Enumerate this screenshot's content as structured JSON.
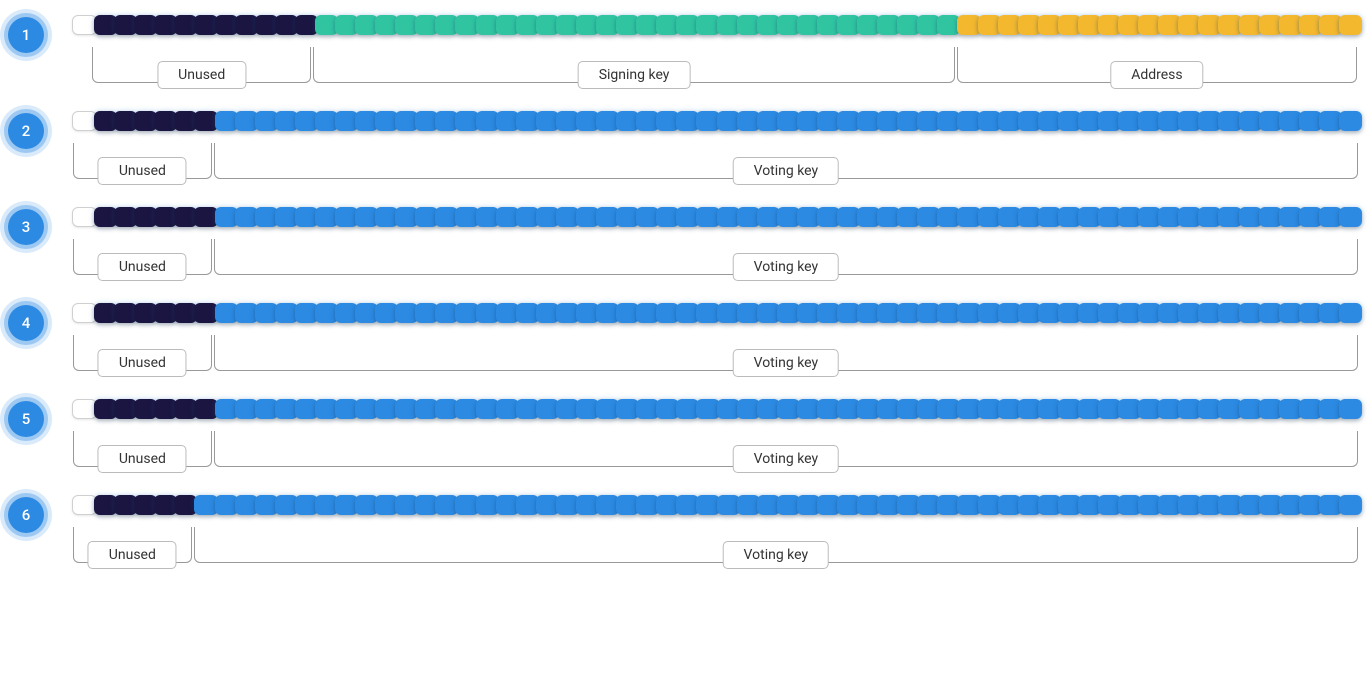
{
  "total_bits": 64,
  "colors": {
    "white": "#ffffff",
    "dark": "#1b1541",
    "teal": "#30c5a0",
    "gold": "#f4b82e",
    "blue": "#2c8ae2"
  },
  "rows": [
    {
      "num": "1",
      "segments": [
        {
          "count": 1,
          "color": "white"
        },
        {
          "count": 11,
          "color": "dark"
        },
        {
          "count": 32,
          "color": "teal"
        },
        {
          "count": 20,
          "color": "gold"
        }
      ],
      "brackets": [
        {
          "span": 12,
          "label": "Unused",
          "skip_first": true
        },
        {
          "span": 32,
          "label": "Signing key"
        },
        {
          "span": 20,
          "label": "Address"
        }
      ]
    },
    {
      "num": "2",
      "segments": [
        {
          "count": 1,
          "color": "white"
        },
        {
          "count": 6,
          "color": "dark"
        },
        {
          "count": 57,
          "color": "blue"
        }
      ],
      "brackets": [
        {
          "span": 7,
          "label": "Unused"
        },
        {
          "span": 57,
          "label": "Voting key"
        }
      ]
    },
    {
      "num": "3",
      "segments": [
        {
          "count": 1,
          "color": "white"
        },
        {
          "count": 6,
          "color": "dark"
        },
        {
          "count": 57,
          "color": "blue"
        }
      ],
      "brackets": [
        {
          "span": 7,
          "label": "Unused"
        },
        {
          "span": 57,
          "label": "Voting key"
        }
      ]
    },
    {
      "num": "4",
      "segments": [
        {
          "count": 1,
          "color": "white"
        },
        {
          "count": 6,
          "color": "dark"
        },
        {
          "count": 57,
          "color": "blue"
        }
      ],
      "brackets": [
        {
          "span": 7,
          "label": "Unused"
        },
        {
          "span": 57,
          "label": "Voting key"
        }
      ]
    },
    {
      "num": "5",
      "segments": [
        {
          "count": 1,
          "color": "white"
        },
        {
          "count": 6,
          "color": "dark"
        },
        {
          "count": 57,
          "color": "blue"
        }
      ],
      "brackets": [
        {
          "span": 7,
          "label": "Unused"
        },
        {
          "span": 57,
          "label": "Voting key"
        }
      ]
    },
    {
      "num": "6",
      "segments": [
        {
          "count": 1,
          "color": "white"
        },
        {
          "count": 5,
          "color": "dark"
        },
        {
          "count": 58,
          "color": "blue"
        }
      ],
      "brackets": [
        {
          "span": 6,
          "label": "Unused"
        },
        {
          "span": 58,
          "label": "Voting key"
        }
      ]
    }
  ]
}
